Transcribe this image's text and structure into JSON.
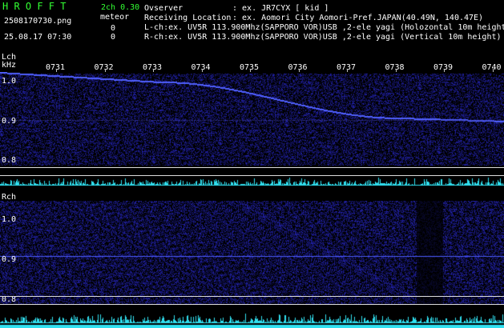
{
  "header": {
    "app_name": "H R O F F T",
    "mode": "2ch 0.30",
    "filename": "2508170730.png",
    "meteor_label": "meteor",
    "datetime": "25.08.17 07:30",
    "count_left": "0",
    "count_right": "0",
    "observer_label": "Ovserver",
    "observer_value": ": ex. JR7CYX [ kid ]",
    "location_label": "Receiving Location",
    "location_value": ": ex. Aomori City Aomori-Pref.JAPAN(40.49N, 140.47E)",
    "lch_desc": "L-ch:ex. UV5R 113.900Mhz(SAPPORO VOR)USB ,2-ele yagi (Holozontal 10m height)",
    "rch_desc": "R-ch:ex. UV5R 113.900Mhz(SAPPORO VOR)USB ,2-ele yagi (Vertical 10m height)"
  },
  "time_ticks": [
    "0731",
    "0732",
    "0733",
    "0734",
    "0735",
    "0736",
    "0737",
    "0738",
    "0739",
    "0740"
  ],
  "left_channel": {
    "label": "Lch",
    "unit": "kHz",
    "freq_labels": [
      "1.0",
      "0.9",
      "0.8"
    ]
  },
  "right_channel": {
    "label": "Rch",
    "freq_labels": [
      "1.0",
      "0.9",
      "0.8"
    ]
  },
  "colors": {
    "background": "#000000",
    "noise": "#1a1a7a",
    "signal": "#4d5cff",
    "baseline": "#30e0f0",
    "title_green": "#33ff33"
  }
}
